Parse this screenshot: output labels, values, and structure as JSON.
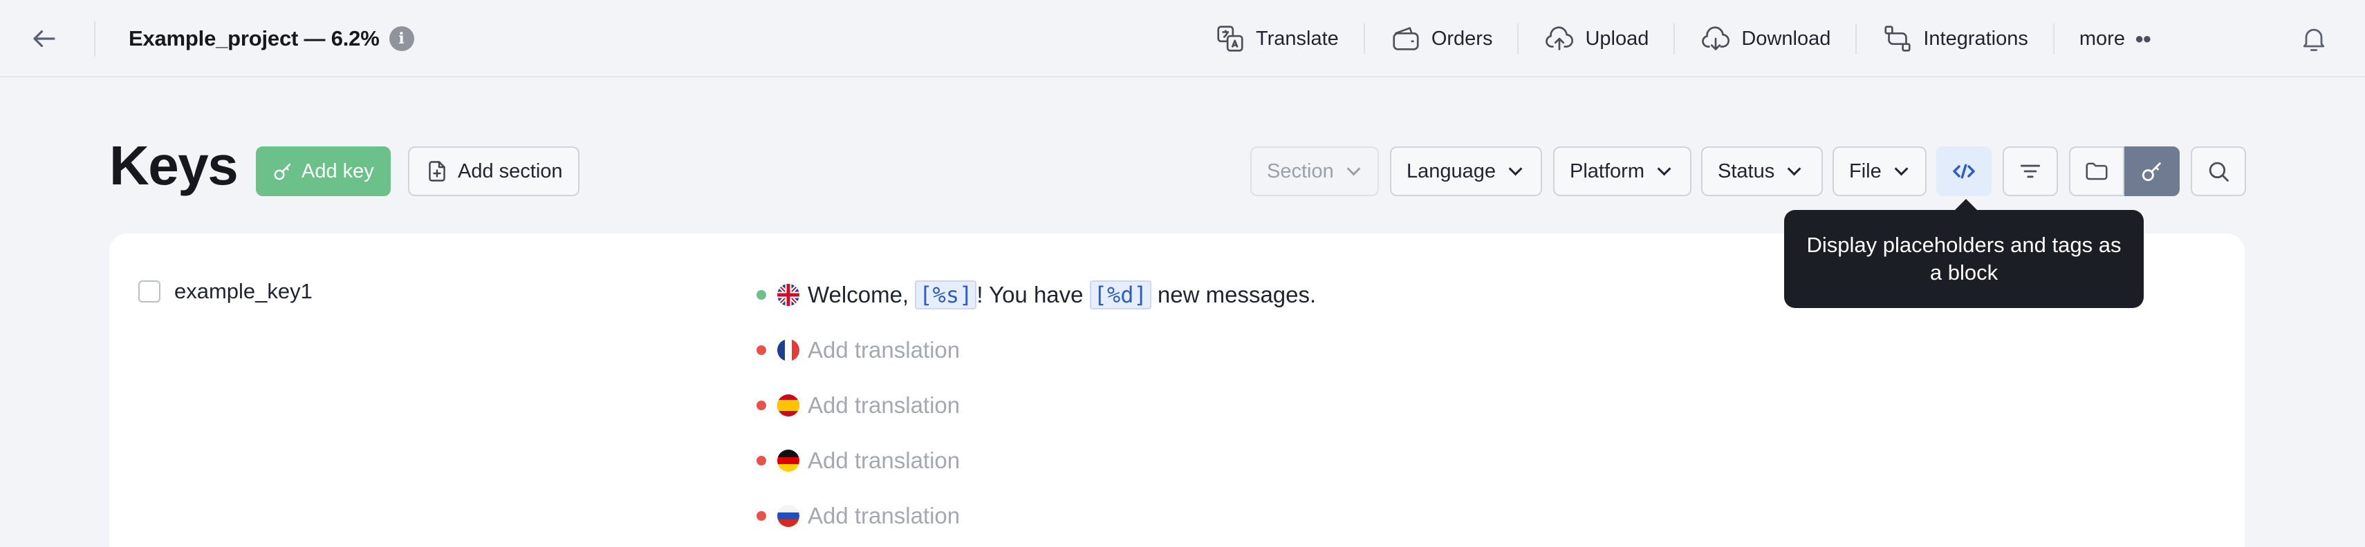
{
  "header": {
    "project_name": "Example_project — 6.2%",
    "nav": [
      {
        "label": "Translate",
        "icon": "translate-icon"
      },
      {
        "label": "Orders",
        "icon": "wallet-icon"
      },
      {
        "label": "Upload",
        "icon": "upload-icon"
      },
      {
        "label": "Download",
        "icon": "download-icon"
      },
      {
        "label": "Integrations",
        "icon": "integrations-icon"
      },
      {
        "label": "more",
        "icon": "more-icon"
      }
    ]
  },
  "toolbar": {
    "title": "Keys",
    "add_key": "Add key",
    "add_section": "Add section",
    "filters": {
      "section": "Section",
      "language": "Language",
      "platform": "Platform",
      "status": "Status",
      "file": "File"
    }
  },
  "tooltip": {
    "text": "Display placeholders and tags as a block"
  },
  "keys": [
    {
      "name": "example_key1",
      "translations": [
        {
          "lang": "en",
          "status_color": "#6cc08a",
          "parts": [
            "Welcome, ",
            "[%s]",
            "! You have ",
            "[%d]",
            " new messages."
          ]
        },
        {
          "lang": "fr",
          "status_color": "#e5534b",
          "placeholder": "Add translation"
        },
        {
          "lang": "es",
          "status_color": "#e5534b",
          "placeholder": "Add translation"
        },
        {
          "lang": "de",
          "status_color": "#e5534b",
          "placeholder": "Add translation"
        },
        {
          "lang": "ru",
          "status_color": "#e5534b",
          "placeholder": "Add translation"
        }
      ]
    }
  ],
  "colors": {
    "primary": "#6cc08a",
    "status_done": "#6cc08a",
    "status_missing": "#e5534b",
    "active_view": "#6f7b91"
  }
}
